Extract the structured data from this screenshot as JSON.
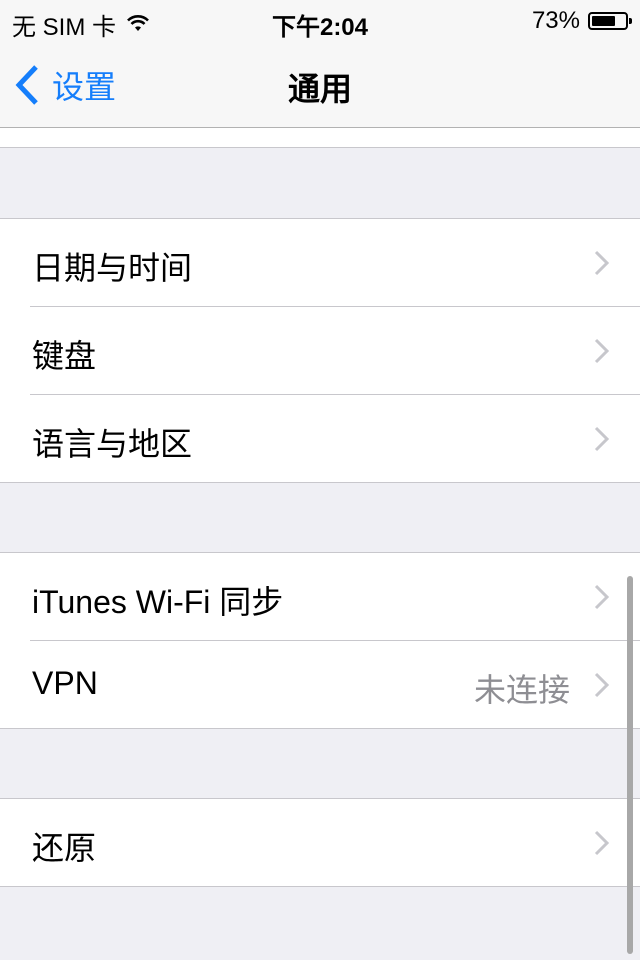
{
  "status_bar": {
    "carrier": "无 SIM 卡",
    "wifi_icon": "wifi-icon",
    "time": "下午2:04",
    "battery_percent_label": "73%",
    "battery_level": 0.73
  },
  "nav": {
    "back_label": "设置",
    "title": "通用",
    "accent_color": "#157efb"
  },
  "groups": [
    {
      "rows": [
        {
          "label": "日期与时间"
        },
        {
          "label": "键盘"
        },
        {
          "label": "语言与地区"
        }
      ]
    },
    {
      "rows": [
        {
          "label": "iTunes Wi-Fi 同步"
        },
        {
          "label": "VPN",
          "value": "未连接"
        }
      ]
    },
    {
      "rows": [
        {
          "label": "还原"
        }
      ]
    }
  ]
}
